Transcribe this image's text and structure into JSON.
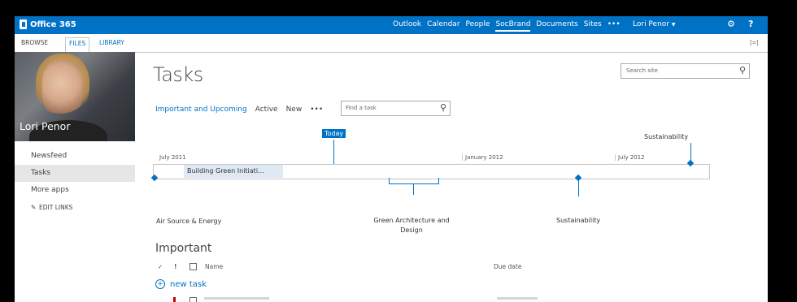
{
  "suitebar": {
    "brand": "Office 365",
    "nav": [
      "Outlook",
      "Calendar",
      "People",
      "SocBrand",
      "Documents",
      "Sites",
      "•••"
    ],
    "active_index": 3,
    "user": "Lori Penor",
    "gear_icon": "⚙",
    "help": "?"
  },
  "ribbon": {
    "browse": "BROWSE",
    "files": "FILES",
    "library": "LIBRARY"
  },
  "profile": {
    "name": "Lori Penor"
  },
  "sidenav": {
    "items": [
      "Newsfeed",
      "Tasks",
      "More apps"
    ],
    "selected_index": 1,
    "edit_links": "EDIT LINKS"
  },
  "page": {
    "title": "Tasks",
    "site_search_placeholder": "Search site"
  },
  "views": {
    "items": [
      "Important and Upcoming",
      "Active",
      "New",
      "•••"
    ],
    "selected_index": 0,
    "find_placeholder": "Find a task"
  },
  "timeline": {
    "today": "Today",
    "ticks": [
      "July 2011",
      "January 2012",
      "July 2012"
    ],
    "bar_task": "Building Green Initiati...",
    "milestones": [
      "Air Source & Energy",
      "Green Architecture and Design",
      "Sustainability",
      "Sustainability"
    ]
  },
  "list": {
    "title": "Important",
    "columns": {
      "name": "Name",
      "due": "Due date"
    },
    "new_task": "new task"
  },
  "colors": {
    "accent": "#0072c6",
    "suitebar": "#0072c6",
    "selected_nav": "#e6e6e6"
  }
}
